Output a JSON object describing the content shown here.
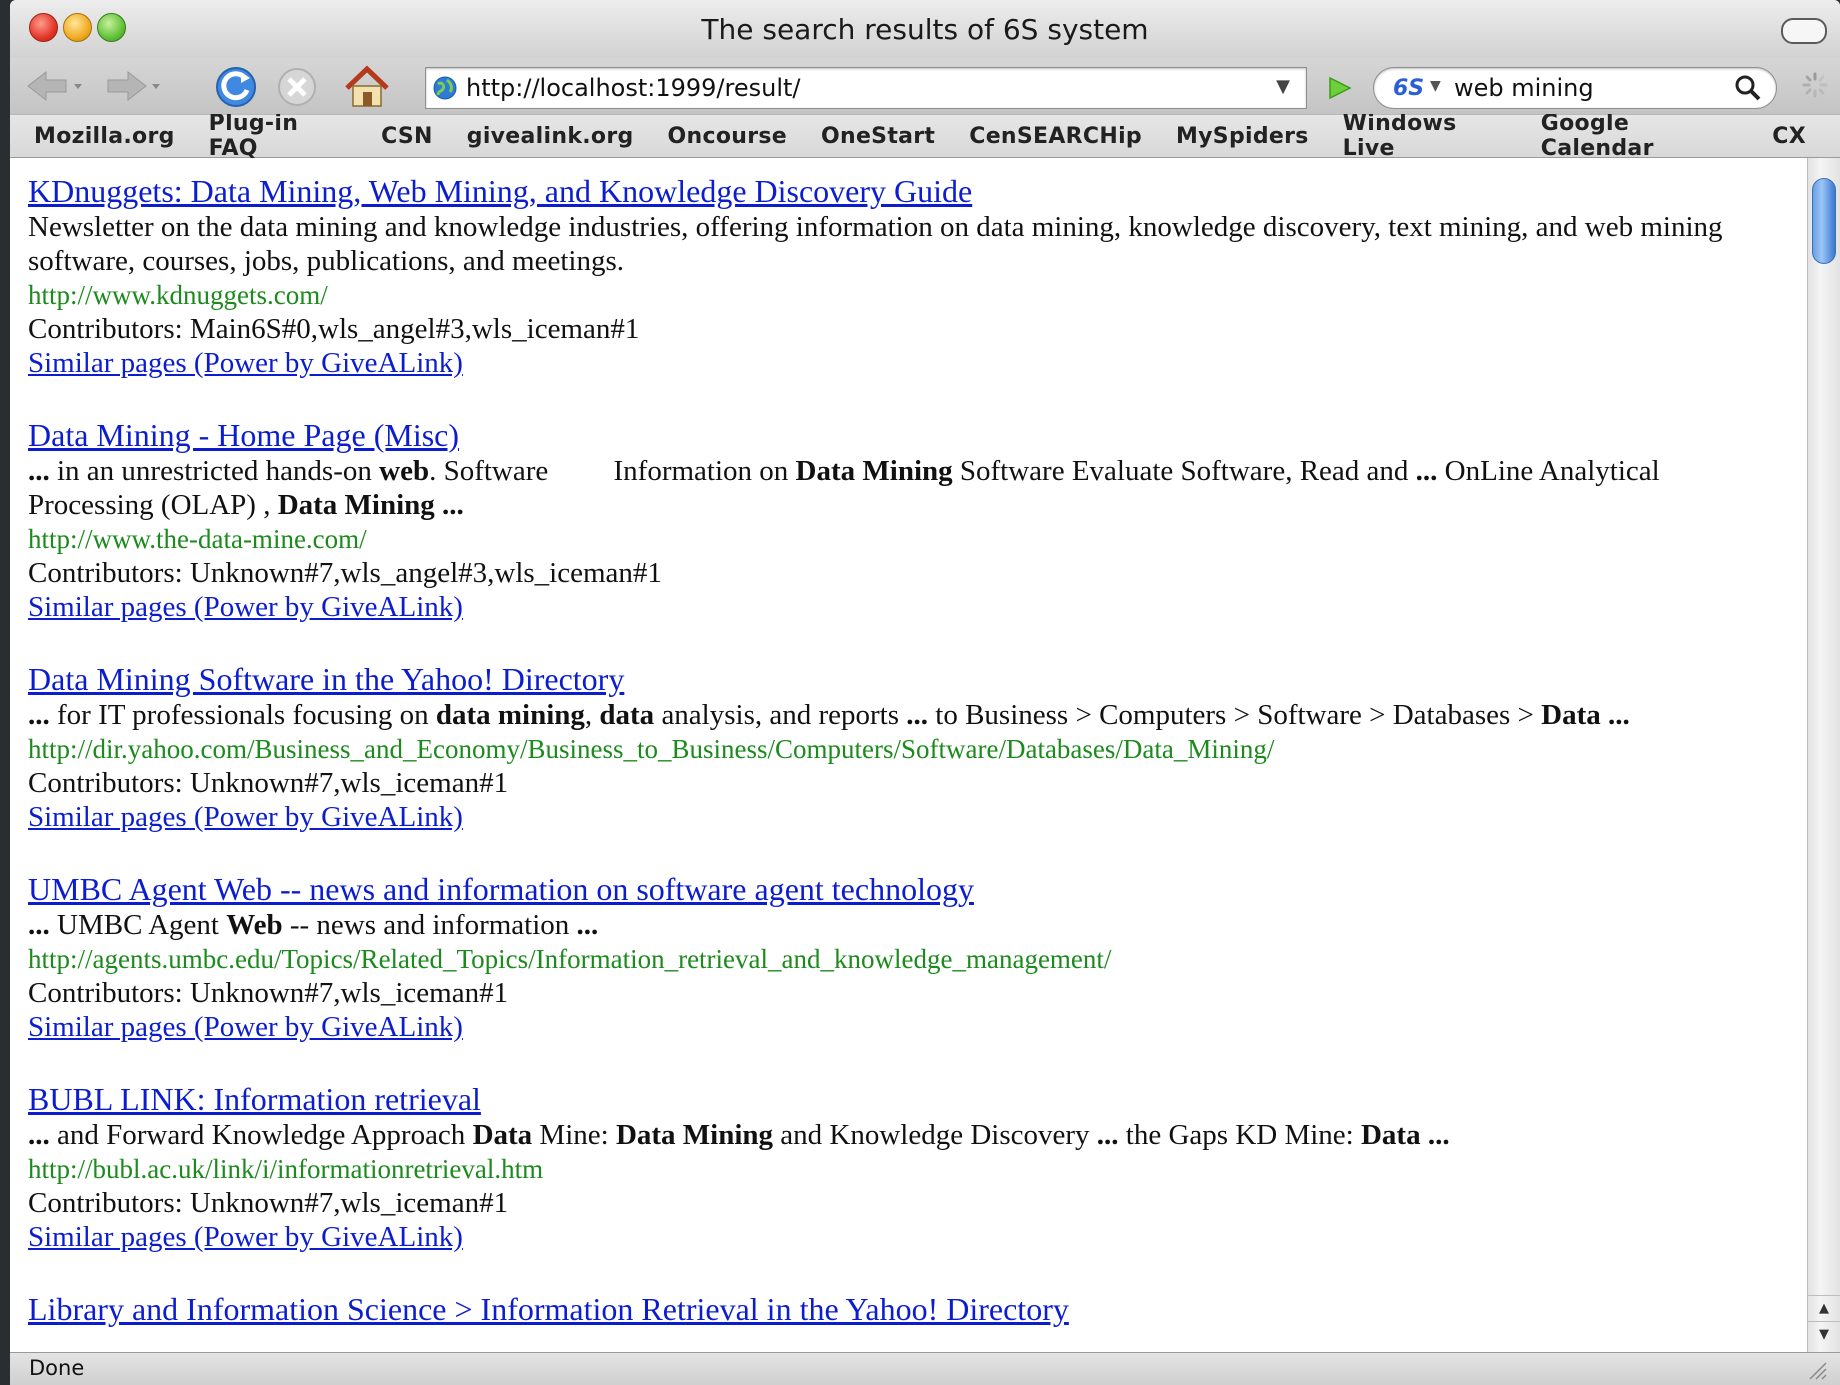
{
  "window": {
    "title": "The search results of 6S system"
  },
  "toolbar": {
    "url": "http://localhost:1999/result/",
    "search_engine": "6S",
    "search_query": "web mining"
  },
  "bookmarks": [
    "Mozilla.org",
    "Plug-in FAQ",
    "CSN",
    "givealink.org",
    "Oncourse",
    "OneStart",
    "CenSEARCHip",
    "MySpiders",
    "Windows Live",
    "Google Calendar",
    "CX"
  ],
  "results": [
    {
      "title": "KDnuggets: Data Mining, Web Mining, and Knowledge Discovery Guide",
      "snippet": [
        {
          "t": "Newsletter on the data mining and knowledge industries, offering information on data mining, knowledge discovery, text mining, and web mining software, courses, jobs, publications, and meetings.",
          "b": false
        }
      ],
      "url": "http://www.kdnuggets.com/",
      "contributors": "Contributors: Main6S#0,wls_angel#3,wls_iceman#1",
      "similar": "Similar pages (Power by GiveALink)"
    },
    {
      "title": "Data Mining - Home Page (Misc)",
      "snippet": [
        {
          "t": "...",
          "b": true
        },
        {
          "t": " in an unrestricted hands-on ",
          "b": false
        },
        {
          "t": "web",
          "b": true
        },
        {
          "t": ". Software         Information on ",
          "b": false
        },
        {
          "t": "Data Mining",
          "b": true
        },
        {
          "t": " Software Evaluate Software, Read and ",
          "b": false
        },
        {
          "t": "...",
          "b": true
        },
        {
          "t": " OnLine Analytical Processing (OLAP) , ",
          "b": false
        },
        {
          "t": "Data Mining ...",
          "b": true
        }
      ],
      "url": "http://www.the-data-mine.com/",
      "contributors": "Contributors: Unknown#7,wls_angel#3,wls_iceman#1",
      "similar": "Similar pages (Power by GiveALink)"
    },
    {
      "title": "Data Mining Software in the Yahoo! Directory",
      "snippet": [
        {
          "t": "...",
          "b": true
        },
        {
          "t": " for IT professionals focusing on ",
          "b": false
        },
        {
          "t": "data mining",
          "b": true
        },
        {
          "t": ", ",
          "b": false
        },
        {
          "t": "data",
          "b": true
        },
        {
          "t": " analysis, and reports ",
          "b": false
        },
        {
          "t": "...",
          "b": true
        },
        {
          "t": " to Business > Computers > Software > Databases > ",
          "b": false
        },
        {
          "t": "Data ...",
          "b": true
        }
      ],
      "url": "http://dir.yahoo.com/Business_and_Economy/Business_to_Business/Computers/Software/Databases/Data_Mining/",
      "contributors": "Contributors: Unknown#7,wls_iceman#1",
      "similar": "Similar pages (Power by GiveALink)"
    },
    {
      "title": "UMBC Agent Web -- news and information on software agent technology",
      "snippet": [
        {
          "t": "...",
          "b": true
        },
        {
          "t": " UMBC Agent ",
          "b": false
        },
        {
          "t": "Web",
          "b": true
        },
        {
          "t": " -- news and information ",
          "b": false
        },
        {
          "t": "...",
          "b": true
        }
      ],
      "url": "http://agents.umbc.edu/Topics/Related_Topics/Information_retrieval_and_knowledge_management/",
      "contributors": "Contributors: Unknown#7,wls_iceman#1",
      "similar": "Similar pages (Power by GiveALink)"
    },
    {
      "title": "BUBL LINK: Information retrieval",
      "snippet": [
        {
          "t": "...",
          "b": true
        },
        {
          "t": " and Forward Knowledge Approach ",
          "b": false
        },
        {
          "t": "Data",
          "b": true
        },
        {
          "t": " Mine: ",
          "b": false
        },
        {
          "t": "Data Mining",
          "b": true
        },
        {
          "t": " and Knowledge Discovery ",
          "b": false
        },
        {
          "t": "...",
          "b": true
        },
        {
          "t": " the Gaps KD Mine: ",
          "b": false
        },
        {
          "t": "Data ...",
          "b": true
        }
      ],
      "url": "http://bubl.ac.uk/link/i/informationretrieval.htm",
      "contributors": "Contributors: Unknown#7,wls_iceman#1",
      "similar": "Similar pages (Power by GiveALink)"
    },
    {
      "title": "Library and Information Science > Information Retrieval in the Yahoo! Directory",
      "snippet": [],
      "url": "",
      "contributors": "",
      "similar": ""
    }
  ],
  "status": {
    "text": "Done"
  },
  "colors": {
    "link": "#0b1dce",
    "url_green": "#1c8a1c",
    "scroll_thumb": "#6aa0e8"
  },
  "icons": [
    "back-arrow-icon",
    "forward-arrow-icon",
    "reload-icon",
    "stop-icon",
    "home-icon",
    "globe-icon",
    "go-arrow-icon",
    "magnifier-icon",
    "spinner-icon",
    "resize-grip-icon"
  ]
}
